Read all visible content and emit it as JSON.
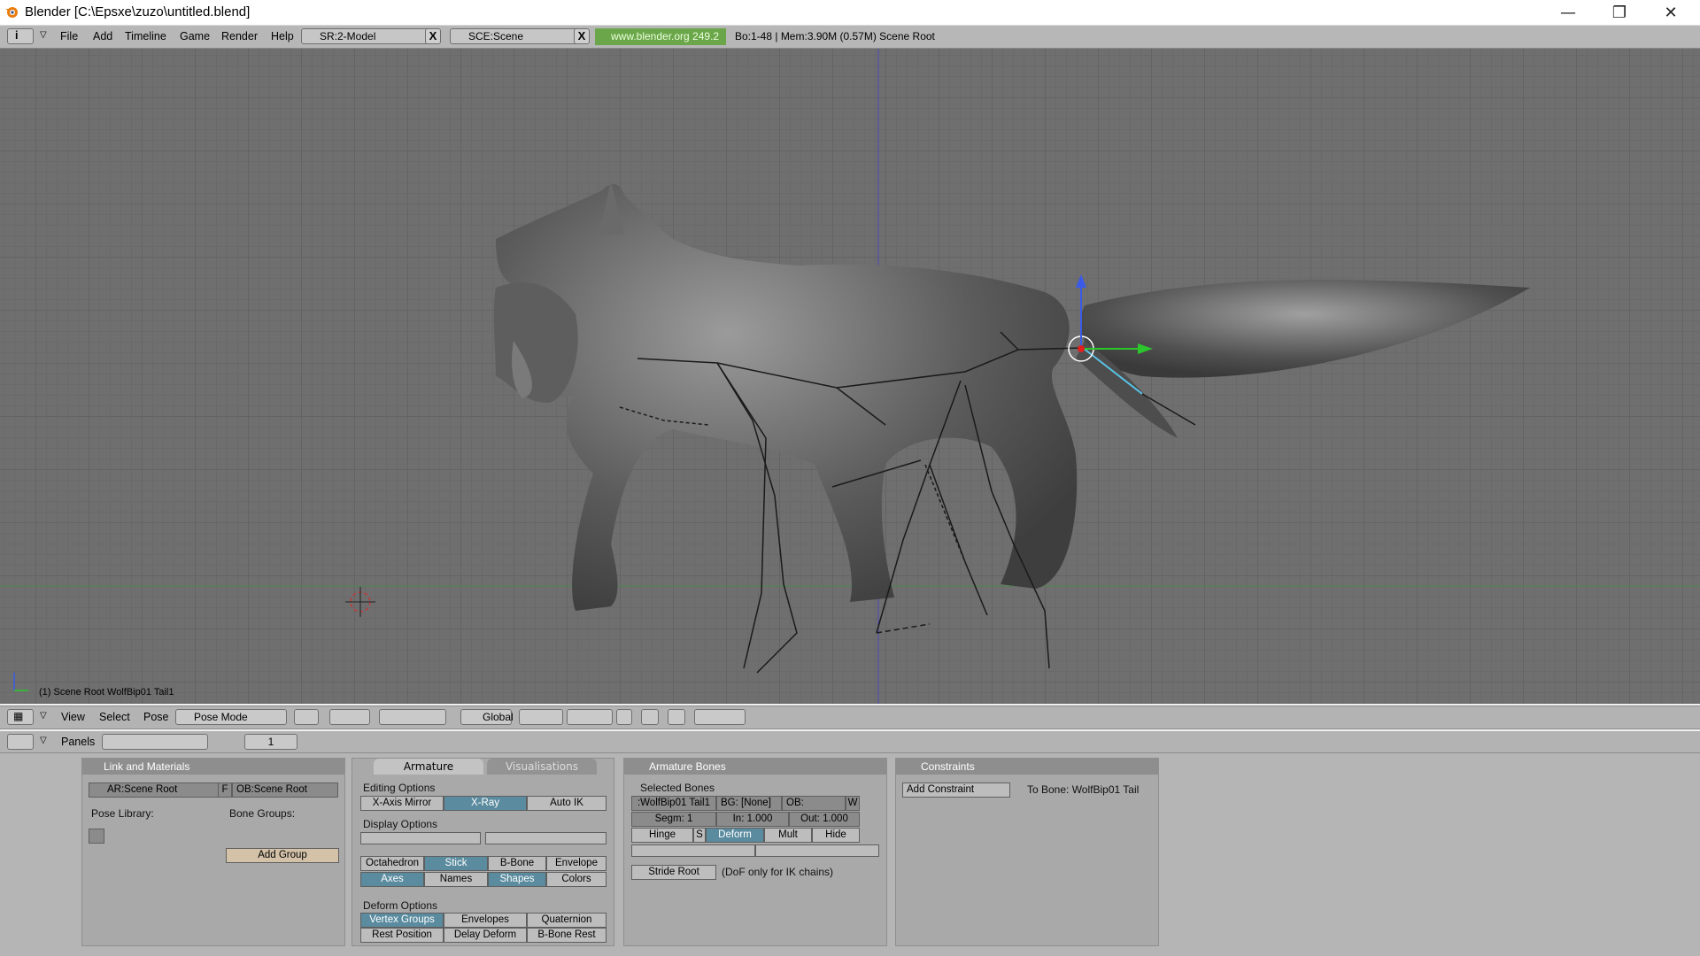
{
  "window": {
    "title": "Blender [C:\\Epsxe\\zuzo\\untitled.blend]",
    "minimize": "—",
    "restore": "❐",
    "close": "✕"
  },
  "infobar": {
    "menus": [
      "File",
      "Add",
      "Timeline",
      "Game",
      "Render",
      "Help"
    ],
    "screen_field": "SR:2-Model",
    "scene_field": "SCE:Scene",
    "x_label": "X",
    "website": "www.blender.org 249.2",
    "stats": "Bo:1-48   | Mem:3.90M (0.57M) Scene Root"
  },
  "viewport": {
    "status": "(1) Scene Root WolfBip01 Tail1",
    "background_color": "#6f6f6f"
  },
  "viewport_header": {
    "menus": [
      "View",
      "Select",
      "Pose"
    ],
    "mode": "Pose Mode",
    "orientation": "Global"
  },
  "buttons_header": {
    "label": "Panels",
    "frame": "1"
  },
  "link_materials": {
    "title": "Link and Materials",
    "armature_field": "AR:Scene Root",
    "f_label": "F",
    "object_field": "OB:Scene Root",
    "pose_library": "Pose Library:",
    "bone_groups": "Bone Groups:",
    "add_group": "Add Group"
  },
  "armature": {
    "tab_active": "Armature",
    "tab_inactive": "Visualisations",
    "editing_options": "Editing Options",
    "x_axis_mirror": "X-Axis Mirror",
    "x_ray": "X-Ray",
    "auto_ik": "Auto IK",
    "display_options": "Display Options",
    "octahedron": "Octahedron",
    "stick": "Stick",
    "b_bone": "B-Bone",
    "envelope": "Envelope",
    "axes": "Axes",
    "names": "Names",
    "shapes": "Shapes",
    "colors": "Colors",
    "deform_options": "Deform Options",
    "vertex_groups": "Vertex Groups",
    "envelopes": "Envelopes",
    "quaternion": "Quaternion",
    "rest_position": "Rest Position",
    "delay_deform": "Delay Deform",
    "b_bone_rest": "B-Bone Rest"
  },
  "armature_bones": {
    "title": "Armature Bones",
    "selected_bones": "Selected Bones",
    "bone_name": ":WolfBip01 Tail1",
    "bg": "BG: [None]",
    "ob": "OB:",
    "w": "W",
    "segm": "Segm: 1",
    "in": "In: 1.000",
    "out": "Out: 1.000",
    "hinge": "Hinge",
    "s": "S",
    "deform": "Deform",
    "mult": "Mult",
    "hide": "Hide",
    "stride_root": "Stride Root",
    "dof_note": "(DoF only for IK chains)"
  },
  "constraints": {
    "title": "Constraints",
    "add_constraint": "Add Constraint",
    "to_bone": "To Bone: WolfBip01 Tail"
  }
}
